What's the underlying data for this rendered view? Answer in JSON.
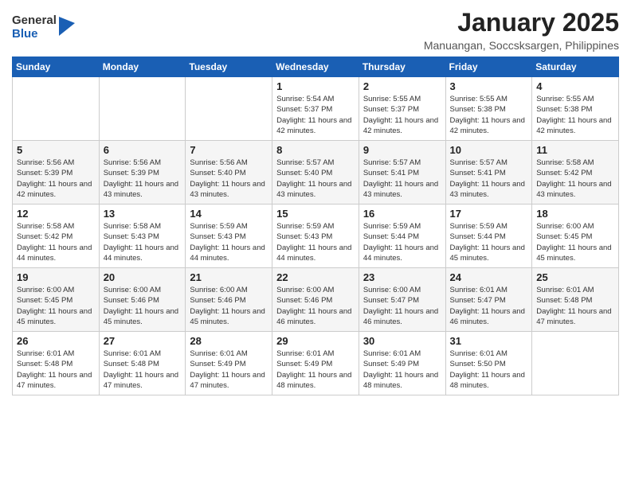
{
  "logo": {
    "general": "General",
    "blue": "Blue"
  },
  "title": "January 2025",
  "subtitle": "Manuangan, Soccsksargen, Philippines",
  "headers": [
    "Sunday",
    "Monday",
    "Tuesday",
    "Wednesday",
    "Thursday",
    "Friday",
    "Saturday"
  ],
  "weeks": [
    [
      {
        "day": "",
        "info": ""
      },
      {
        "day": "",
        "info": ""
      },
      {
        "day": "",
        "info": ""
      },
      {
        "day": "1",
        "info": "Sunrise: 5:54 AM\nSunset: 5:37 PM\nDaylight: 11 hours and 42 minutes."
      },
      {
        "day": "2",
        "info": "Sunrise: 5:55 AM\nSunset: 5:37 PM\nDaylight: 11 hours and 42 minutes."
      },
      {
        "day": "3",
        "info": "Sunrise: 5:55 AM\nSunset: 5:38 PM\nDaylight: 11 hours and 42 minutes."
      },
      {
        "day": "4",
        "info": "Sunrise: 5:55 AM\nSunset: 5:38 PM\nDaylight: 11 hours and 42 minutes."
      }
    ],
    [
      {
        "day": "5",
        "info": "Sunrise: 5:56 AM\nSunset: 5:39 PM\nDaylight: 11 hours and 42 minutes."
      },
      {
        "day": "6",
        "info": "Sunrise: 5:56 AM\nSunset: 5:39 PM\nDaylight: 11 hours and 43 minutes."
      },
      {
        "day": "7",
        "info": "Sunrise: 5:56 AM\nSunset: 5:40 PM\nDaylight: 11 hours and 43 minutes."
      },
      {
        "day": "8",
        "info": "Sunrise: 5:57 AM\nSunset: 5:40 PM\nDaylight: 11 hours and 43 minutes."
      },
      {
        "day": "9",
        "info": "Sunrise: 5:57 AM\nSunset: 5:41 PM\nDaylight: 11 hours and 43 minutes."
      },
      {
        "day": "10",
        "info": "Sunrise: 5:57 AM\nSunset: 5:41 PM\nDaylight: 11 hours and 43 minutes."
      },
      {
        "day": "11",
        "info": "Sunrise: 5:58 AM\nSunset: 5:42 PM\nDaylight: 11 hours and 43 minutes."
      }
    ],
    [
      {
        "day": "12",
        "info": "Sunrise: 5:58 AM\nSunset: 5:42 PM\nDaylight: 11 hours and 44 minutes."
      },
      {
        "day": "13",
        "info": "Sunrise: 5:58 AM\nSunset: 5:43 PM\nDaylight: 11 hours and 44 minutes."
      },
      {
        "day": "14",
        "info": "Sunrise: 5:59 AM\nSunset: 5:43 PM\nDaylight: 11 hours and 44 minutes."
      },
      {
        "day": "15",
        "info": "Sunrise: 5:59 AM\nSunset: 5:43 PM\nDaylight: 11 hours and 44 minutes."
      },
      {
        "day": "16",
        "info": "Sunrise: 5:59 AM\nSunset: 5:44 PM\nDaylight: 11 hours and 44 minutes."
      },
      {
        "day": "17",
        "info": "Sunrise: 5:59 AM\nSunset: 5:44 PM\nDaylight: 11 hours and 45 minutes."
      },
      {
        "day": "18",
        "info": "Sunrise: 6:00 AM\nSunset: 5:45 PM\nDaylight: 11 hours and 45 minutes."
      }
    ],
    [
      {
        "day": "19",
        "info": "Sunrise: 6:00 AM\nSunset: 5:45 PM\nDaylight: 11 hours and 45 minutes."
      },
      {
        "day": "20",
        "info": "Sunrise: 6:00 AM\nSunset: 5:46 PM\nDaylight: 11 hours and 45 minutes."
      },
      {
        "day": "21",
        "info": "Sunrise: 6:00 AM\nSunset: 5:46 PM\nDaylight: 11 hours and 45 minutes."
      },
      {
        "day": "22",
        "info": "Sunrise: 6:00 AM\nSunset: 5:46 PM\nDaylight: 11 hours and 46 minutes."
      },
      {
        "day": "23",
        "info": "Sunrise: 6:00 AM\nSunset: 5:47 PM\nDaylight: 11 hours and 46 minutes."
      },
      {
        "day": "24",
        "info": "Sunrise: 6:01 AM\nSunset: 5:47 PM\nDaylight: 11 hours and 46 minutes."
      },
      {
        "day": "25",
        "info": "Sunrise: 6:01 AM\nSunset: 5:48 PM\nDaylight: 11 hours and 47 minutes."
      }
    ],
    [
      {
        "day": "26",
        "info": "Sunrise: 6:01 AM\nSunset: 5:48 PM\nDaylight: 11 hours and 47 minutes."
      },
      {
        "day": "27",
        "info": "Sunrise: 6:01 AM\nSunset: 5:48 PM\nDaylight: 11 hours and 47 minutes."
      },
      {
        "day": "28",
        "info": "Sunrise: 6:01 AM\nSunset: 5:49 PM\nDaylight: 11 hours and 47 minutes."
      },
      {
        "day": "29",
        "info": "Sunrise: 6:01 AM\nSunset: 5:49 PM\nDaylight: 11 hours and 48 minutes."
      },
      {
        "day": "30",
        "info": "Sunrise: 6:01 AM\nSunset: 5:49 PM\nDaylight: 11 hours and 48 minutes."
      },
      {
        "day": "31",
        "info": "Sunrise: 6:01 AM\nSunset: 5:50 PM\nDaylight: 11 hours and 48 minutes."
      },
      {
        "day": "",
        "info": ""
      }
    ]
  ]
}
